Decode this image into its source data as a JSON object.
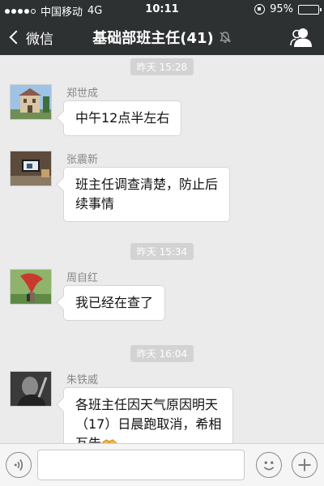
{
  "statusbar": {
    "carrier": "中国移动",
    "network": "4G",
    "time": "10:11",
    "battery": "95%",
    "battery_level": 0.95
  },
  "nav": {
    "back_label": "微信",
    "title": "基础部班主任(41)"
  },
  "chat": {
    "timestamps": [
      "昨天 15:28",
      "昨天 15:34",
      "昨天 16:04"
    ],
    "messages": [
      {
        "sender": "郑世成",
        "text": "中午12点半左右"
      },
      {
        "sender": "张震新",
        "line1": "班主任调查清楚，防止后",
        "line2": "续事情"
      },
      {
        "sender": "周自红",
        "text": "我已经在查了"
      },
      {
        "sender": "朱铁威",
        "line1": "各班主任因天气原因明天",
        "line2": "（17）日晨跑取消，希相",
        "line3": "互告"
      }
    ]
  },
  "colors": {
    "bar": "#2e3132",
    "chat_bg": "#ebebeb",
    "bubble": "#ffffff",
    "timestamp_bg": "#d3d3d3"
  },
  "icons": [
    "signal-dots-icon",
    "rotation-lock-icon",
    "battery-icon",
    "back-chevron-icon",
    "mute-icon",
    "group-members-icon",
    "voice-icon",
    "emoji-icon",
    "plus-icon",
    "handshake-emoji"
  ]
}
